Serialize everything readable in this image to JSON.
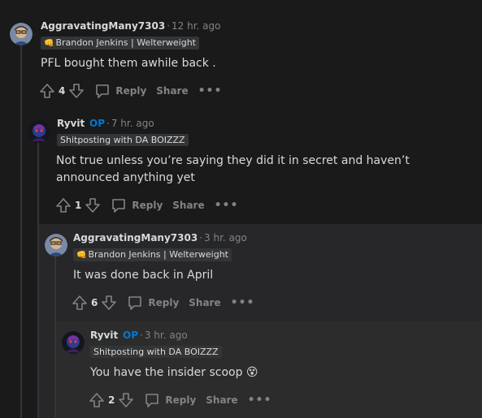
{
  "comments": [
    {
      "username": "AggravatingMany7303",
      "op_label": "",
      "time": "12 hr. ago",
      "flair": "Brandon Jenkins | Welterweight",
      "flair_icon": "fist-icon",
      "body": "PFL bought them awhile back .",
      "score": "4",
      "reply_label": "Reply",
      "share_label": "Share",
      "more_label": "•••"
    },
    {
      "username": "Ryvit",
      "op_label": "OP",
      "time": "7 hr. ago",
      "flair": "Shitposting with DA BOIZZZ",
      "body": "Not true unless you’re saying they did it in secret and haven’t announced anything yet",
      "score": "1",
      "reply_label": "Reply",
      "share_label": "Share",
      "more_label": "•••"
    },
    {
      "username": "AggravatingMany7303",
      "op_label": "",
      "time": "3 hr. ago",
      "flair": "Brandon Jenkins | Welterweight",
      "flair_icon": "fist-icon",
      "body": "It was done back in April",
      "score": "6",
      "reply_label": "Reply",
      "share_label": "Share",
      "more_label": "•••"
    },
    {
      "username": "Ryvit",
      "op_label": "OP",
      "time": "3 hr. ago",
      "flair": "Shitposting with DA BOIZZZ",
      "body": "You have the insider scoop 😵",
      "score": "2",
      "reply_label": "Reply",
      "share_label": "Share",
      "more_label": "•••"
    }
  ],
  "colors": {
    "background": "#1a1a1b",
    "op": "#0079d3",
    "flair_bg": "#343536",
    "muted": "#818384"
  }
}
